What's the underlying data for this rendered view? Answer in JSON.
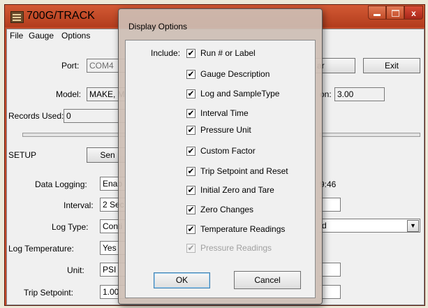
{
  "window": {
    "title": "700G/TRACK",
    "minimize_label": "",
    "maximize_label": "",
    "close_label": "x"
  },
  "menu": [
    "File",
    "Gauge",
    "Options"
  ],
  "main": {
    "port_label": "Port:",
    "port_value": "COM4",
    "clear_button_fragment": "ar",
    "exit_button": "Exit",
    "model_label": "Model:",
    "model_value": "MAKE, M",
    "version_label_fragment": "on:",
    "version_value": "3.00",
    "records_label": "Records Used:",
    "records_value": "0",
    "setup_label": "SETUP",
    "send_button_fragment": "Sen",
    "data_logging_label": "Data Logging:",
    "data_logging_value": "Enab",
    "time_fragment": "9:46",
    "interval_label": "Interval:",
    "interval_value": "2 Sec",
    "log_type_label": "Log Type:",
    "log_type_value": "Conti",
    "right_combo_value": "d",
    "log_temp_label": "Log Temperature:",
    "log_temp_value": "Yes",
    "unit_label": "Unit:",
    "unit_value": "PSI",
    "trip_label": "Trip Setpoint:",
    "trip_value": "1.00"
  },
  "dialog": {
    "title": "Display Options",
    "include_label": "Include:",
    "options": [
      {
        "label": "Run # or Label",
        "checked": true,
        "enabled": true
      },
      {
        "label": "Gauge Description",
        "checked": true,
        "enabled": true
      },
      {
        "label": "Log and SampleType",
        "checked": true,
        "enabled": true
      },
      {
        "label": "Interval Time",
        "checked": true,
        "enabled": true
      },
      {
        "label": "Pressure Unit",
        "checked": true,
        "enabled": true
      },
      {
        "label": "Custom Factor",
        "checked": true,
        "enabled": true
      },
      {
        "label": "Trip Setpoint and Reset",
        "checked": true,
        "enabled": true
      },
      {
        "label": "Initial Zero and Tare",
        "checked": true,
        "enabled": true
      },
      {
        "label": "Zero Changes",
        "checked": true,
        "enabled": true
      },
      {
        "label": "Temperature Readings",
        "checked": true,
        "enabled": true
      },
      {
        "label": "Pressure Readings",
        "checked": true,
        "enabled": false
      }
    ],
    "check_glyph": "✔",
    "ok_label": "OK",
    "cancel_label": "Cancel"
  }
}
